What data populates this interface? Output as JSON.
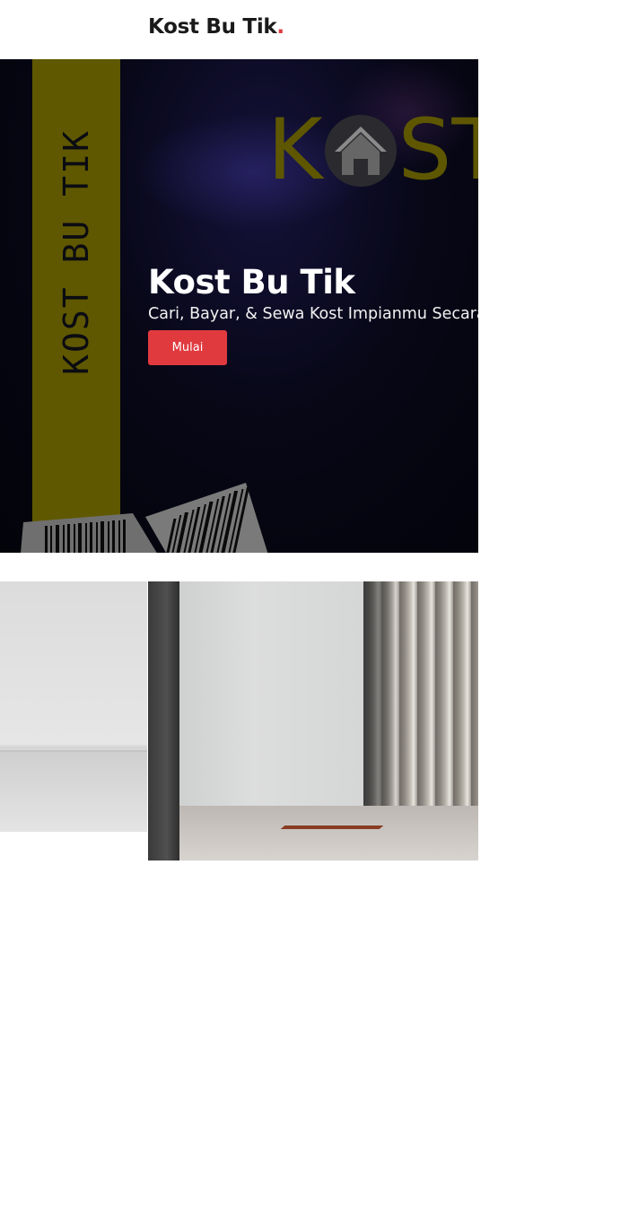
{
  "header": {
    "brand_name": "Kost Bu Tik",
    "brand_dot": "."
  },
  "hero": {
    "vertical_logo_text": "KOST BU TIK",
    "logo_letter_k": "K",
    "logo_letters_st": "ST",
    "title": "Kost Bu Tik",
    "subtitle": "Cari, Bayar, & Sewa Kost Impianmu Secara",
    "cta_label": "Mulai",
    "house_icon": "house-icon"
  },
  "colors": {
    "accent": "#e03a3f",
    "logo_yellow": "#5f5800",
    "hero_bg": "#05050f"
  }
}
